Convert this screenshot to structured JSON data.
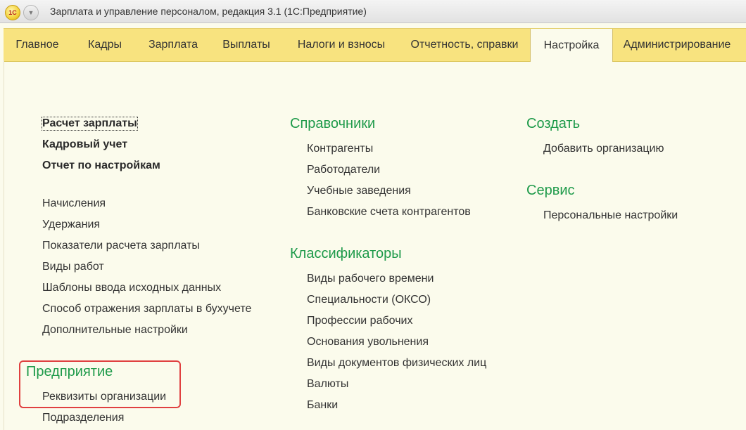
{
  "window": {
    "title": "Зарплата и управление персоналом, редакция 3.1  (1С:Предприятие)",
    "logo_text": "1С",
    "menu_icon": "chevron-down-icon"
  },
  "tabs": [
    {
      "label": "Главное"
    },
    {
      "label": "Кадры"
    },
    {
      "label": "Зарплата"
    },
    {
      "label": "Выплаты"
    },
    {
      "label": "Налоги и взносы"
    },
    {
      "label": "Отчетность, справки"
    },
    {
      "label": "Настройка",
      "active": true
    },
    {
      "label": "Администрирование"
    }
  ],
  "col1": {
    "bold_links": [
      "Расчет зарплаты",
      "Кадровый учет",
      "Отчет по настройкам"
    ],
    "links": [
      "Начисления",
      "Удержания",
      "Показатели расчета зарплаты",
      "Виды работ",
      "Шаблоны ввода исходных данных",
      "Способ отражения зарплаты в бухучете",
      "Дополнительные настройки"
    ],
    "enterprise": {
      "title": "Предприятие",
      "links": [
        "Реквизиты организации",
        "Подразделения"
      ]
    }
  },
  "col2": {
    "directories": {
      "title": "Справочники",
      "links": [
        "Контрагенты",
        "Работодатели",
        "Учебные заведения",
        "Банковские счета контрагентов"
      ]
    },
    "classifiers": {
      "title": "Классификаторы",
      "links": [
        "Виды рабочего времени",
        "Специальности (ОКСО)",
        "Профессии рабочих",
        "Основания увольнения",
        "Виды документов физических лиц",
        "Валюты",
        "Банки"
      ]
    }
  },
  "col3": {
    "create": {
      "title": "Создать",
      "links": [
        "Добавить организацию"
      ]
    },
    "service": {
      "title": "Сервис",
      "links": [
        "Персональные настройки"
      ]
    }
  },
  "colors": {
    "tab_bar": "#f8e37f",
    "group_title": "#1e9a4a",
    "highlight_frame": "#e04040"
  }
}
